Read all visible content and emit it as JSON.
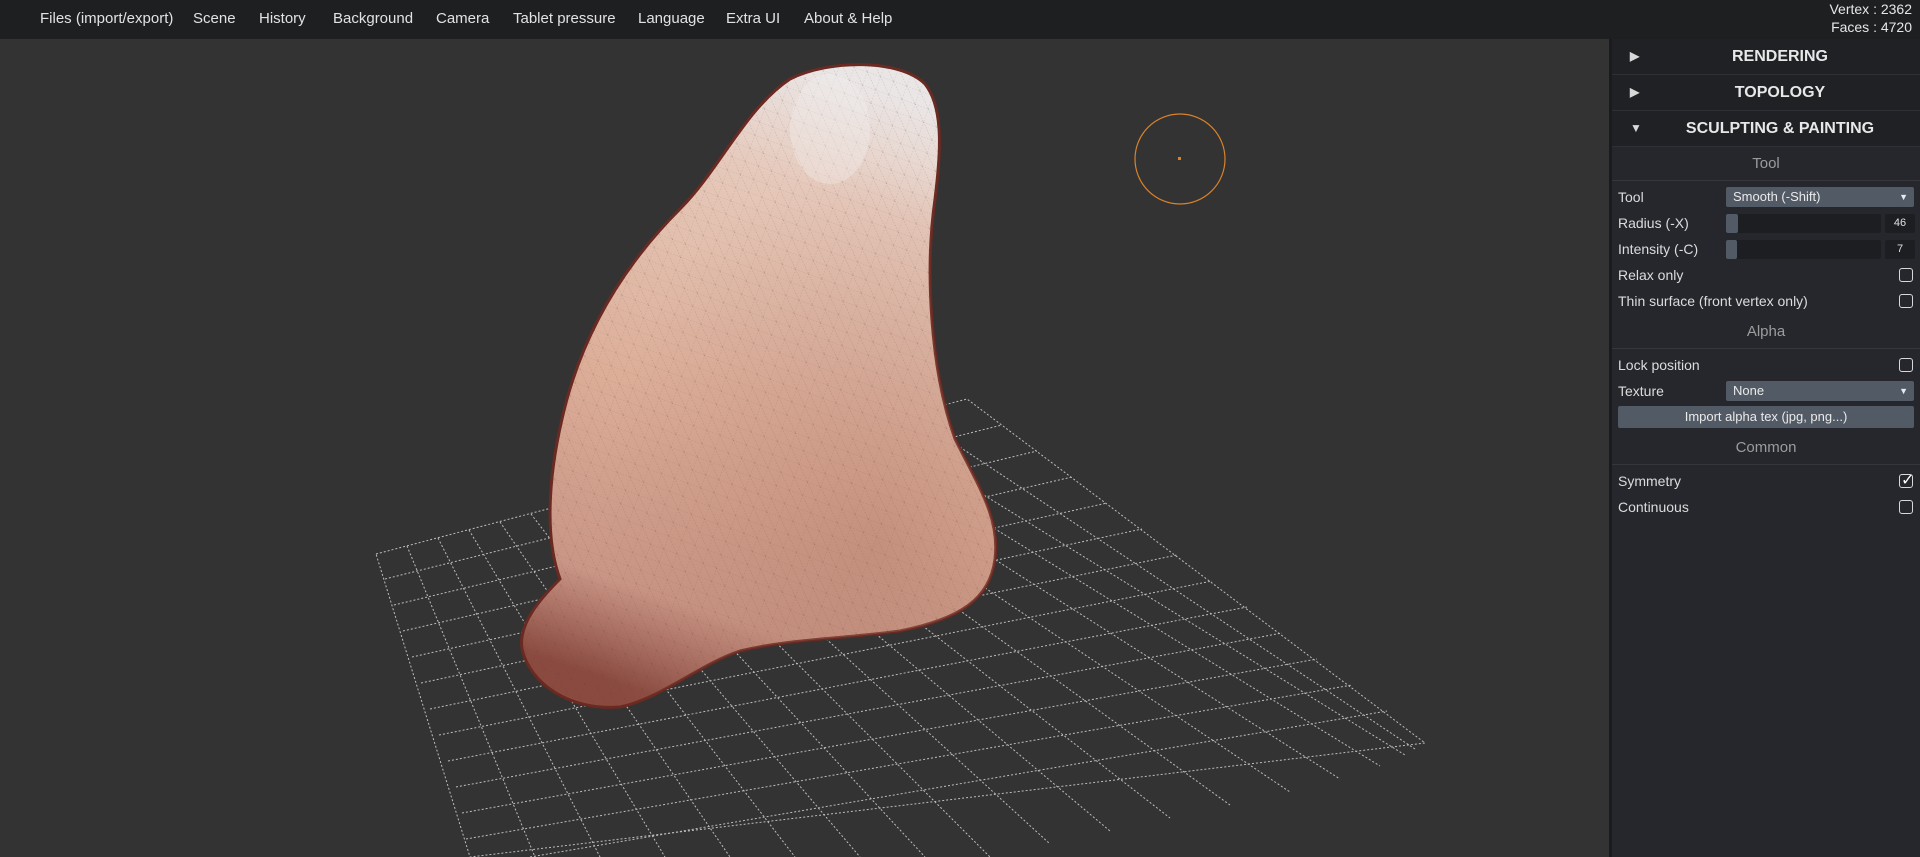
{
  "menu": {
    "items": [
      "Files (import/export)",
      "Scene",
      "History",
      "Background",
      "Camera",
      "Tablet pressure",
      "Language",
      "Extra UI",
      "About & Help"
    ]
  },
  "stats": {
    "vertex": "Vertex : 2362",
    "faces": "Faces : 4720"
  },
  "sidebar": {
    "folders": [
      {
        "arrow": "▶",
        "title": "RENDERING"
      },
      {
        "arrow": "▶",
        "title": "TOPOLOGY"
      },
      {
        "arrow": "▼",
        "title": "SCULPTING & PAINTING"
      }
    ],
    "tool_section": {
      "title": "Tool",
      "tool_label": "Tool",
      "tool_value": "Smooth (-Shift)",
      "radius_label": "Radius (-X)",
      "radius_value": "46",
      "radius_fraction": 0.08,
      "intensity_label": "Intensity (-C)",
      "intensity_value": "7",
      "intensity_fraction": 0.07,
      "relax_label": "Relax only",
      "relax_checked": false,
      "thin_label": "Thin surface (front vertex only)",
      "thin_checked": false
    },
    "alpha_section": {
      "title": "Alpha",
      "lock_label": "Lock position",
      "lock_checked": false,
      "texture_label": "Texture",
      "texture_value": "None",
      "import_button": "Import alpha tex (jpg, png...)"
    },
    "common_section": {
      "title": "Common",
      "symmetry_label": "Symmetry",
      "symmetry_checked": true,
      "continuous_label": "Continuous",
      "continuous_checked": false
    }
  },
  "colors": {
    "brush_ring": "#d9822b",
    "mesh_light": "#e9c6b2",
    "mesh_dark": "#7a3a30"
  }
}
